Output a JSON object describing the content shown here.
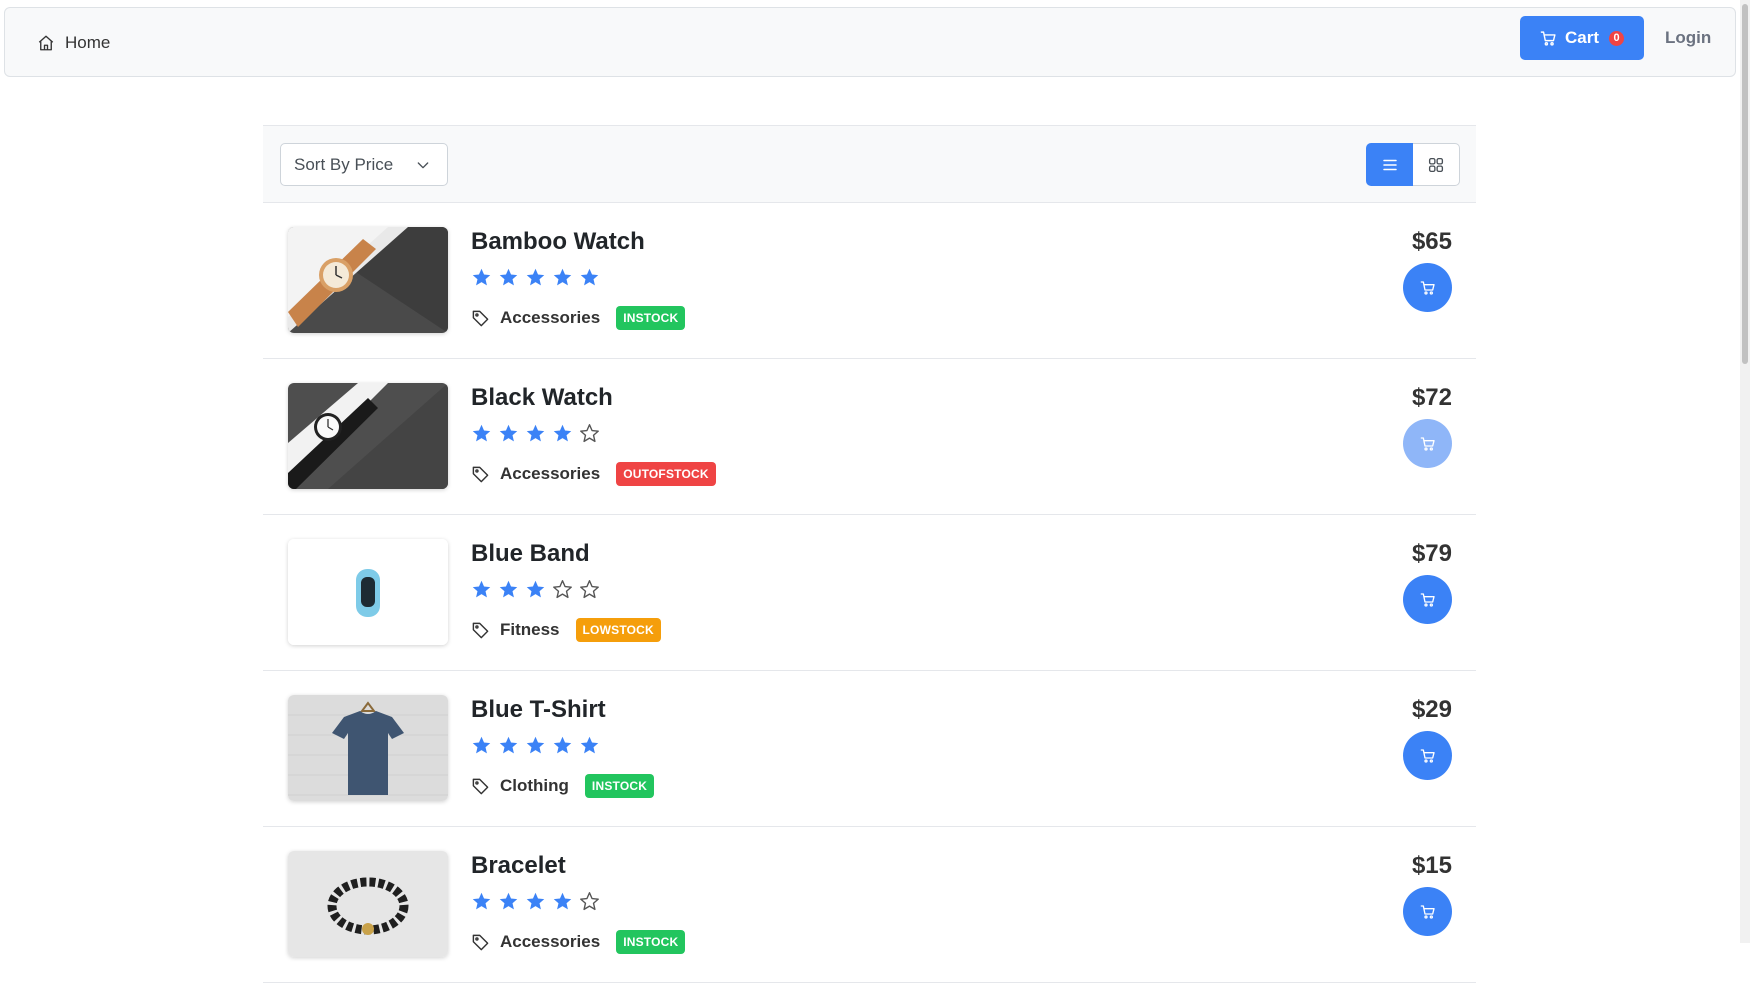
{
  "nav": {
    "home_label": "Home",
    "cart_label": "Cart",
    "cart_count": "0",
    "login_label": "Login"
  },
  "dataview": {
    "sort_placeholder": "Sort By Price",
    "active_layout": "list"
  },
  "colors": {
    "primary": "#3b82f6",
    "instock": "#22c55e",
    "outofstock": "#ef4444",
    "lowstock": "#f59e0b",
    "star": "#3b82f6"
  },
  "products": [
    {
      "name": "Bamboo Watch",
      "rating": 5,
      "category": "Accessories",
      "status": "INSTOCK",
      "status_color": "#22c55e",
      "price": "$65",
      "image": "bamboo-watch",
      "cart_enabled": true
    },
    {
      "name": "Black Watch",
      "rating": 4,
      "category": "Accessories",
      "status": "OUTOFSTOCK",
      "status_color": "#ef4444",
      "price": "$72",
      "image": "black-watch",
      "cart_enabled": false
    },
    {
      "name": "Blue Band",
      "rating": 3,
      "category": "Fitness",
      "status": "LOWSTOCK",
      "status_color": "#f59e0b",
      "price": "$79",
      "image": "blue-band",
      "cart_enabled": true
    },
    {
      "name": "Blue T-Shirt",
      "rating": 5,
      "category": "Clothing",
      "status": "INSTOCK",
      "status_color": "#22c55e",
      "price": "$29",
      "image": "blue-tshirt",
      "cart_enabled": true
    },
    {
      "name": "Bracelet",
      "rating": 4,
      "category": "Accessories",
      "status": "INSTOCK",
      "status_color": "#22c55e",
      "price": "$15",
      "image": "bracelet",
      "cart_enabled": true
    }
  ]
}
